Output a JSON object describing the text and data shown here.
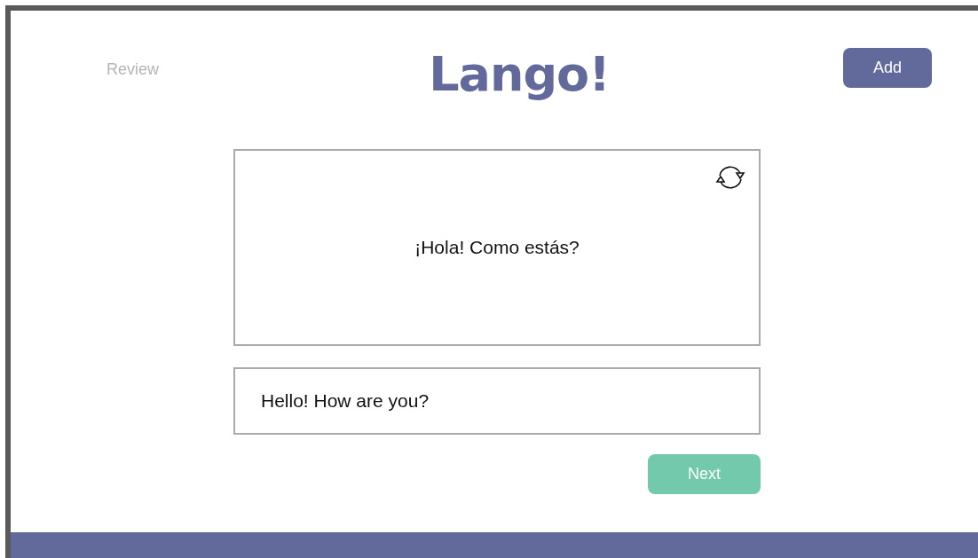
{
  "header": {
    "review_link": "Review",
    "logo": "Lango!",
    "add_button": "Add"
  },
  "card": {
    "text": "¡Hola! Como estás?"
  },
  "answer": {
    "value": "Hello! How are you?"
  },
  "next_button": "Next"
}
